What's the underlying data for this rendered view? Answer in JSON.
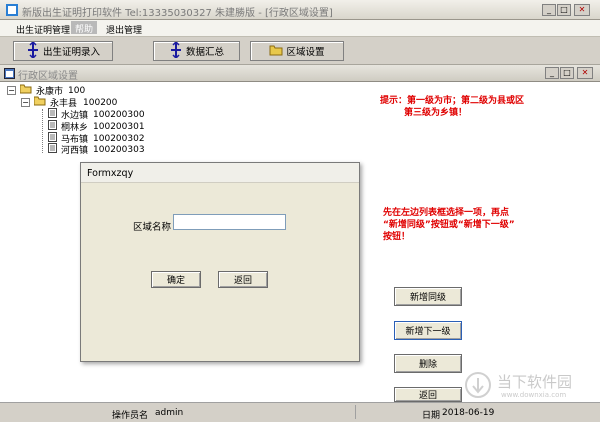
{
  "title": "新版出生证明打印软件  Tel:13335030327 朱建勝版    -  [行政区域设置]",
  "menu": {
    "items": [
      "出生证明管理",
      "帮助",
      "退出管理"
    ]
  },
  "toolbar": {
    "buttons": [
      "出生证明录入",
      "数据汇总",
      "区域设置"
    ]
  },
  "mdi": {
    "title": "行政区域设置"
  },
  "tree": {
    "city": {
      "name": "永康市",
      "code": "100"
    },
    "county": {
      "name": "永丰县",
      "code": "100200"
    },
    "towns": [
      {
        "name": "水边镇",
        "code": "100200300"
      },
      {
        "name": "桐林乡",
        "code": "100200301"
      },
      {
        "name": "马布镇",
        "code": "100200302"
      },
      {
        "name": "河西镇",
        "code": "100200303"
      }
    ]
  },
  "hints": {
    "hint1_line1": "提示：第一级为市；第二级为县或区",
    "hint1_line2": "第三级为乡镇！",
    "hint2_line1": "先在左边列表框选择一项，再点",
    "hint2_line2": "“新增同级”按钮或“新增下一级”",
    "hint2_line3": "按钮！"
  },
  "buttons": {
    "add_same": "新增同级",
    "add_child": "新增下一级",
    "delete": "删除",
    "back": "返回"
  },
  "dialog": {
    "title": "Formxzqy",
    "label": "区域名称",
    "input_value": "",
    "ok": "确定",
    "cancel": "返回"
  },
  "status": {
    "operator_label": "操作员名",
    "operator": "admin",
    "date_label": "日期",
    "date": "2018-06-19"
  },
  "watermark": {
    "text": "当下软件园",
    "url": "www.downxia.com"
  },
  "colors": {
    "title_bar": "#0a246a",
    "hint_red": "#e00000"
  }
}
